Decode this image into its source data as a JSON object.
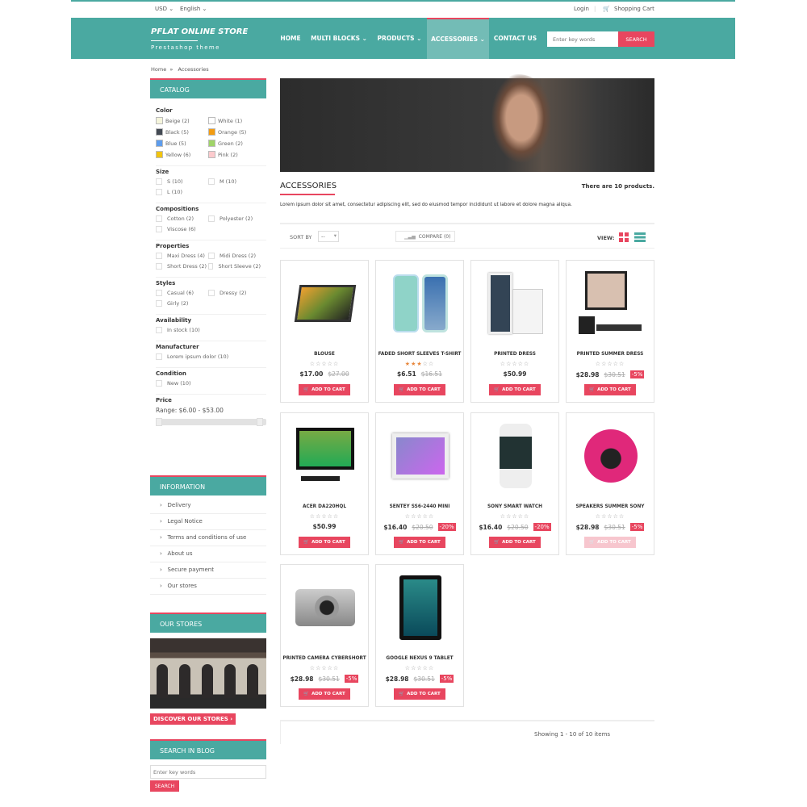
{
  "topbar": {
    "currency": "USD",
    "language": "English",
    "login": "Login",
    "cart": "Shopping Cart"
  },
  "header": {
    "logo_title": "PFLAT ONLINE STORE",
    "logo_subtitle": "Prestashop theme",
    "nav": [
      "HOME",
      "MULTI BLOCKS",
      "PRODUCTS",
      "ACCESSORIES",
      "CONTACT US"
    ],
    "active_nav": "ACCESSORIES",
    "search_placeholder": "Enter key words",
    "search_button": "SEARCH"
  },
  "breadcrumb": {
    "home": "Home",
    "sep": "»",
    "current": "Accessories"
  },
  "colors": {
    "teal": "#4aa9a1",
    "accent": "#e8465f"
  },
  "catalog": {
    "title": "CATALOG",
    "color_label": "Color",
    "colors": [
      {
        "label": "Beige (2)",
        "hex": "#f5f5dc"
      },
      {
        "label": "White (1)",
        "hex": "#ffffff"
      },
      {
        "label": "Black (5)",
        "hex": "#434a54"
      },
      {
        "label": "Orange (5)",
        "hex": "#f39c11"
      },
      {
        "label": "Blue (5)",
        "hex": "#5d9cec"
      },
      {
        "label": "Green (2)",
        "hex": "#a0d468"
      },
      {
        "label": "Yellow (6)",
        "hex": "#f1c40f"
      },
      {
        "label": "Pink (2)",
        "hex": "#fccacd"
      }
    ],
    "groups": [
      {
        "label": "Size",
        "options": [
          "S (10)",
          "M (10)",
          "L (10)"
        ]
      },
      {
        "label": "Compositions",
        "options": [
          "Cotton (2)",
          "Polyester (2)",
          "Viscose (6)"
        ]
      },
      {
        "label": "Properties",
        "options": [
          "Maxi Dress (4)",
          "Midi Dress (2)",
          "Short Dress (2)",
          "Short Sleeve (2)"
        ]
      },
      {
        "label": "Styles",
        "options": [
          "Casual (6)",
          "Dressy (2)",
          "Girly (2)"
        ]
      },
      {
        "label": "Availability",
        "options": [
          "In stock (10)"
        ]
      },
      {
        "label": "Manufacturer",
        "options": [
          "Lorem ipsum dolor (10)"
        ]
      },
      {
        "label": "Condition",
        "options": [
          "New (10)"
        ]
      }
    ],
    "price_label": "Price",
    "price_range": "Range: $6.00 - $53.00"
  },
  "information": {
    "title": "INFORMATION",
    "items": [
      "Delivery",
      "Legal Notice",
      "Terms and conditions of use",
      "About us",
      "Secure payment",
      "Our stores"
    ]
  },
  "our_stores": {
    "title": "OUR STORES",
    "button": "DISCOVER OUR STORES ›"
  },
  "blog_search": {
    "title": "SEARCH IN BLOG",
    "placeholder": "Enter key words",
    "button": "SEARCH"
  },
  "category": {
    "title": "ACCESSORIES",
    "count": "There are 10 products.",
    "description": "Lorem ipsum dolor sit amet, consectetur adipiscing elit, sed do eiusmod tempor incididunt ut labore et dolore magna aliqua."
  },
  "toolbar": {
    "sort_label": "SORT BY",
    "sort_value": "--",
    "compare": "COMPARE (0)",
    "view_label": "VIEW:"
  },
  "products": [
    {
      "name": "BLOUSE",
      "price": "$17.00",
      "old": "$27.00",
      "discount": "",
      "rating": 0,
      "img": "tablet-laptop"
    },
    {
      "name": "FADED SHORT SLEEVES T-SHIRT",
      "price": "$6.51",
      "old": "$16.51",
      "discount": "",
      "rating": 3,
      "img": "phones"
    },
    {
      "name": "PRINTED DRESS",
      "price": "$50.99",
      "old": "",
      "discount": "",
      "rating": 0,
      "img": "phone-white"
    },
    {
      "name": "PRINTED SUMMER DRESS",
      "price": "$28.98",
      "old": "$30.51",
      "discount": "-5%",
      "rating": 0,
      "img": "desktop"
    },
    {
      "name": "ACER DA220HQL",
      "price": "$50.99",
      "old": "",
      "discount": "",
      "rating": 0,
      "img": "monitor"
    },
    {
      "name": "SENTEY SS6-2440 MINI",
      "price": "$16.40",
      "old": "$20.50",
      "discount": "-20%",
      "rating": 0,
      "img": "tablet-white"
    },
    {
      "name": "SONY SMART WATCH",
      "price": "$16.40",
      "old": "$20.50",
      "discount": "-20%",
      "rating": 0,
      "img": "watch"
    },
    {
      "name": "SPEAKERS SUMMER SONY",
      "price": "$28.98",
      "old": "$30.51",
      "discount": "-5%",
      "rating": 0,
      "img": "speaker"
    },
    {
      "name": "PRINTED CAMERA CYBERSHORT",
      "price": "$28.98",
      "old": "$30.51",
      "discount": "-5%",
      "rating": 0,
      "img": "camera"
    },
    {
      "name": "GOOGLE NEXUS 9 TABLET",
      "price": "$28.98",
      "old": "$30.51",
      "discount": "-5%",
      "rating": 0,
      "img": "tablet-black"
    }
  ],
  "add_to_cart": "ADD TO CART",
  "pagination": {
    "summary": "Showing 1 - 10 of 10 items"
  }
}
